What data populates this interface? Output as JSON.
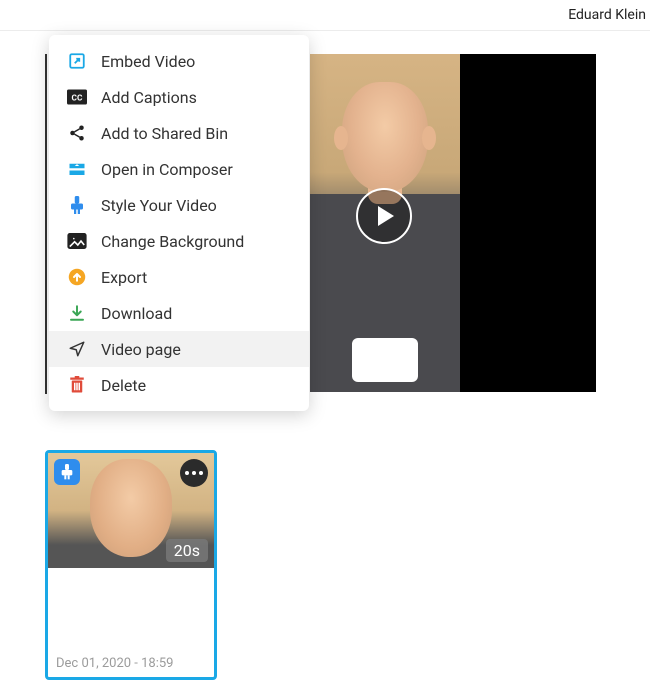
{
  "header": {
    "user_name": "Eduard Klein"
  },
  "menu": {
    "items": [
      {
        "label": "Embed Video",
        "icon": "external-link-icon",
        "highlighted": false
      },
      {
        "label": "Add Captions",
        "icon": "cc-icon",
        "highlighted": false
      },
      {
        "label": "Add to Shared Bin",
        "icon": "share-icon",
        "highlighted": false
      },
      {
        "label": "Open in Composer",
        "icon": "composer-icon",
        "highlighted": false
      },
      {
        "label": "Style Your Video",
        "icon": "style-icon",
        "highlighted": false
      },
      {
        "label": "Change Background",
        "icon": "image-icon",
        "highlighted": false
      },
      {
        "label": "Export",
        "icon": "export-icon",
        "highlighted": false
      },
      {
        "label": "Download",
        "icon": "download-icon",
        "highlighted": false
      },
      {
        "label": "Video page",
        "icon": "send-icon",
        "highlighted": true
      },
      {
        "label": "Delete",
        "icon": "trash-icon",
        "highlighted": false
      }
    ]
  },
  "video_card": {
    "duration": "20s",
    "timestamp": "Dec 01, 2020 - 18:59"
  },
  "colors": {
    "accent": "#1aa8e6",
    "primary_blue": "#2f8ded",
    "orange": "#f5a623",
    "green": "#3aa655",
    "red": "#e04b3a"
  }
}
